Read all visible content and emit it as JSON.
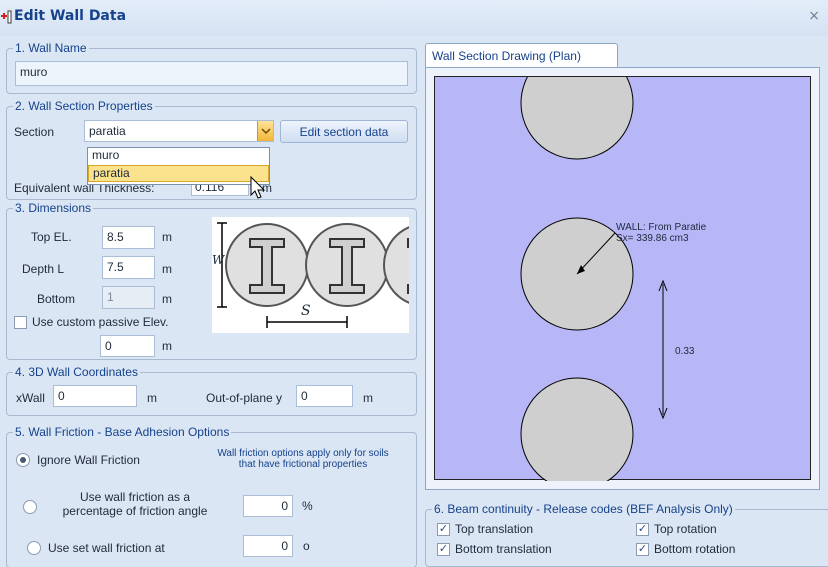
{
  "window": {
    "title": "Edit Wall Data",
    "close_label": "×"
  },
  "wall_name": {
    "legend": "1. Wall Name",
    "value": "muro"
  },
  "section_props": {
    "legend": "2. Wall Section Properties",
    "section_label": "Section",
    "section_value": "paratia",
    "edit_button": "Edit section data",
    "options": [
      "muro",
      "paratia"
    ],
    "thickness_label": "Equivalent wall Thickness:",
    "thickness_value": "0.116",
    "thickness_unit": "m"
  },
  "dimensions": {
    "legend": "3. Dimensions",
    "top_label": "Top EL.",
    "top_value": "8.5",
    "top_unit": "m",
    "depth_label": "Depth L",
    "depth_value": "7.5",
    "depth_unit": "m",
    "bottom_label": "Bottom",
    "bottom_value": "1",
    "bottom_unit": "m",
    "custom_passive_label": "Use custom passive Elev.",
    "custom_passive_value": "0",
    "custom_passive_unit": "m",
    "image_label_w": "W",
    "image_label_s": "S"
  },
  "coordinates": {
    "legend": "4. 3D Wall Coordinates",
    "x_label": "xWall",
    "x_value": "0",
    "x_unit": "m",
    "y_label": "Out-of-plane y",
    "y_value": "0",
    "y_unit": "m"
  },
  "friction": {
    "legend": "5. Wall Friction - Base Adhesion Options",
    "ignore_label": "Ignore Wall Friction",
    "note": "Wall friction options apply only for soils that have frictional properties",
    "percent_label": "Use wall friction as a percentage of friction angle",
    "percent_value": "0",
    "percent_unit": "%",
    "set_label": "Use set wall friction at",
    "set_value": "0",
    "set_unit": "o"
  },
  "drawing": {
    "tab_label": "Wall Section Drawing (Plan)",
    "annotation_line1": "WALL: From Paratie",
    "annotation_line2": "Sx= 339.86 cm3",
    "spacing_label": "0.33",
    "colors": {
      "background": "#b7b7f7",
      "pile_fill": "#cfcfcf"
    }
  },
  "beam": {
    "legend": "6. Beam continuity - Release codes (BEF Analysis Only)",
    "top_translation": "Top translation",
    "top_rotation": "Top rotation",
    "bottom_translation": "Bottom translation",
    "bottom_rotation": "Bottom rotation",
    "check_mark": "✓"
  }
}
